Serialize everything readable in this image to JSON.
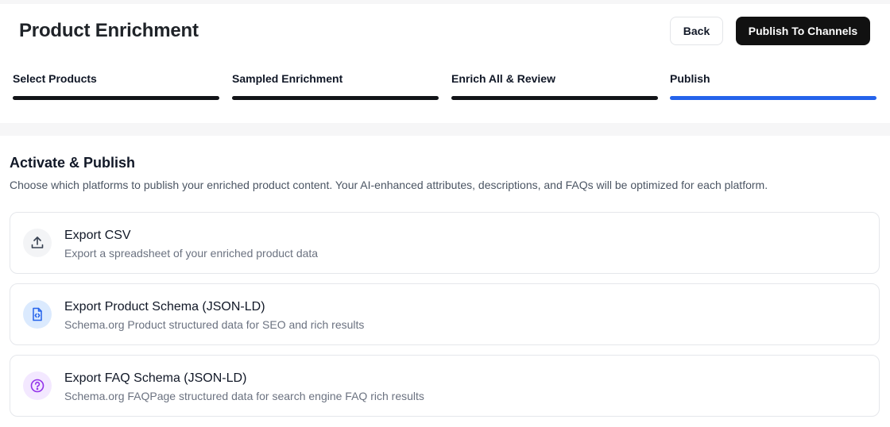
{
  "header": {
    "title": "Product Enrichment",
    "back_label": "Back",
    "publish_label": "Publish To Channels"
  },
  "steps": [
    {
      "label": "Select Products",
      "status": "complete"
    },
    {
      "label": "Sampled Enrichment",
      "status": "complete"
    },
    {
      "label": "Enrich All & Review",
      "status": "complete"
    },
    {
      "label": "Publish",
      "status": "active"
    }
  ],
  "section": {
    "title": "Activate & Publish",
    "description": "Choose which platforms to publish your enriched product content. Your AI-enhanced attributes, descriptions, and FAQs will be optimized for each platform."
  },
  "options": [
    {
      "title": "Export CSV",
      "description": "Export a spreadsheet of your enriched product data",
      "icon": "upload-icon"
    },
    {
      "title": "Export Product Schema (JSON-LD)",
      "description": "Schema.org Product structured data for SEO and rich results",
      "icon": "code-file-icon"
    },
    {
      "title": "Export FAQ Schema (JSON-LD)",
      "description": "Schema.org FAQPage structured data for search engine FAQ rich results",
      "icon": "question-circle-icon"
    }
  ],
  "colors": {
    "primary_button": "#111111",
    "active_step": "#2563eb",
    "complete_step": "#121418",
    "blue_icon": "#2563eb",
    "purple_icon": "#9333ea"
  }
}
